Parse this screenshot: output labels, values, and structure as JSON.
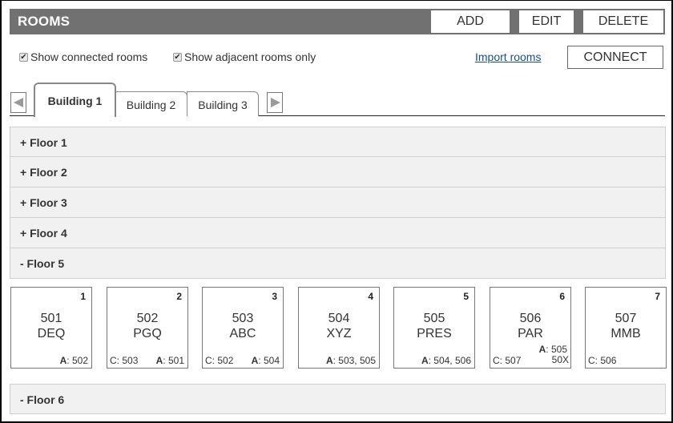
{
  "header": {
    "title": "ROOMS",
    "buttons": {
      "add": "ADD",
      "edit": "EDIT",
      "delete": "DELETE"
    }
  },
  "options": {
    "show_connected": {
      "label": "Show connected rooms",
      "checked": true
    },
    "show_adjacent": {
      "label": "Show adjacent rooms only",
      "checked": true
    },
    "import_link": "Import rooms",
    "connect_button": "CONNECT"
  },
  "tabs": {
    "items": [
      {
        "label": "Building 1",
        "active": true
      },
      {
        "label": "Building 2",
        "active": false
      },
      {
        "label": "Building 3",
        "active": false
      }
    ],
    "prev_icon": "triangle-left",
    "next_icon": "triangle-right"
  },
  "floors": [
    {
      "label": "+ Floor 1",
      "expanded": false
    },
    {
      "label": "+ Floor 2",
      "expanded": false
    },
    {
      "label": "+ Floor 3",
      "expanded": false
    },
    {
      "label": "+ Floor 4",
      "expanded": false
    },
    {
      "label": "- Floor 5",
      "expanded": true
    },
    {
      "label": "- Floor 6",
      "expanded": true
    }
  ],
  "labels": {
    "connected": "C",
    "adjacent": "A"
  },
  "rooms": [
    {
      "index": "1",
      "number": "501",
      "name": "DEQ",
      "connected": "",
      "adjacent": "502",
      "extra": ""
    },
    {
      "index": "2",
      "number": "502",
      "name": "PGQ",
      "connected": "503",
      "adjacent": "501",
      "extra": ""
    },
    {
      "index": "3",
      "number": "503",
      "name": "ABC",
      "connected": "502",
      "adjacent": "504",
      "extra": ""
    },
    {
      "index": "4",
      "number": "504",
      "name": "XYZ",
      "connected": "",
      "adjacent": "503, 505",
      "extra": ""
    },
    {
      "index": "5",
      "number": "505",
      "name": "PRES",
      "connected": "",
      "adjacent": "504, 506",
      "extra": ""
    },
    {
      "index": "6",
      "number": "506",
      "name": "PAR",
      "connected": "507",
      "adjacent": "505",
      "extra": "50X"
    },
    {
      "index": "7",
      "number": "507",
      "name": "MMB",
      "connected": "506",
      "adjacent": "",
      "extra": ""
    }
  ]
}
